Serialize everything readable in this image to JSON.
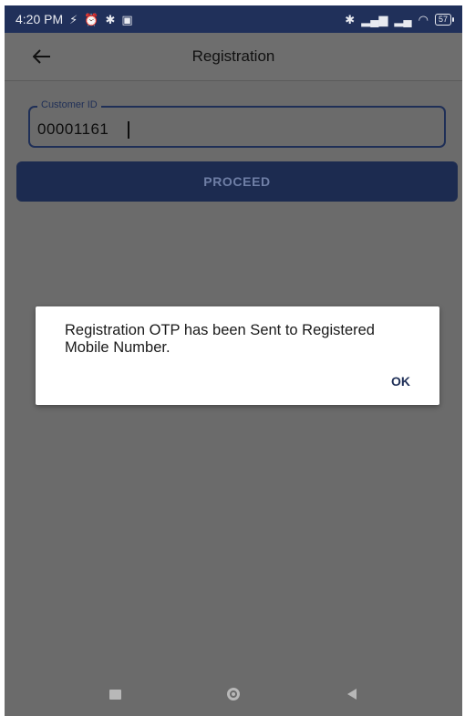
{
  "status_bar": {
    "time": "4:20 PM",
    "battery": "57"
  },
  "app_bar": {
    "title": "Registration"
  },
  "form": {
    "customer_id_label": "Customer ID",
    "customer_id_value": "00001161",
    "proceed_label": "PROCEED"
  },
  "dialog": {
    "message": "Registration OTP has been Sent to Registered Mobile Number.",
    "ok_label": "OK"
  },
  "colors": {
    "primary": "#1c2b50",
    "status_bar": "#20305a",
    "scrim": "#6b6b6b"
  },
  "icons": {
    "back": "arrow-left-icon",
    "bluetooth": "bluetooth-icon",
    "wifi": "wifi-icon",
    "alarm": "alarm-icon"
  }
}
